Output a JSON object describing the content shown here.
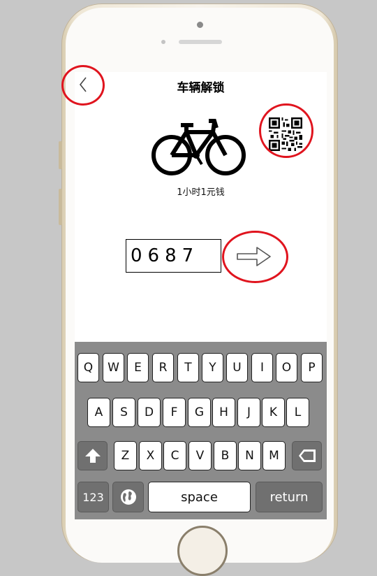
{
  "header": {
    "title": "车辆解锁"
  },
  "bike": {
    "price_text": "1小时1元钱"
  },
  "unlock": {
    "code_value": "0687"
  },
  "keyboard": {
    "row1": [
      "Q",
      "W",
      "E",
      "R",
      "T",
      "Y",
      "U",
      "I",
      "O",
      "P"
    ],
    "row2": [
      "A",
      "S",
      "D",
      "F",
      "G",
      "H",
      "J",
      "K",
      "L"
    ],
    "row3": [
      "Z",
      "X",
      "C",
      "V",
      "B",
      "N",
      "M"
    ],
    "numbers_label": "123",
    "space_label": "space",
    "return_label": "return"
  },
  "colors": {
    "annotation": "#e0141e",
    "keyboard_bg": "#8b8b8b",
    "key_dark": "#707070",
    "backdrop": "#c7c7c7"
  },
  "icons": [
    "back-chevron-icon",
    "bicycle-icon",
    "qr-code-icon",
    "arrow-right-icon",
    "shift-arrow-icon",
    "backspace-icon",
    "globe-icon"
  ]
}
